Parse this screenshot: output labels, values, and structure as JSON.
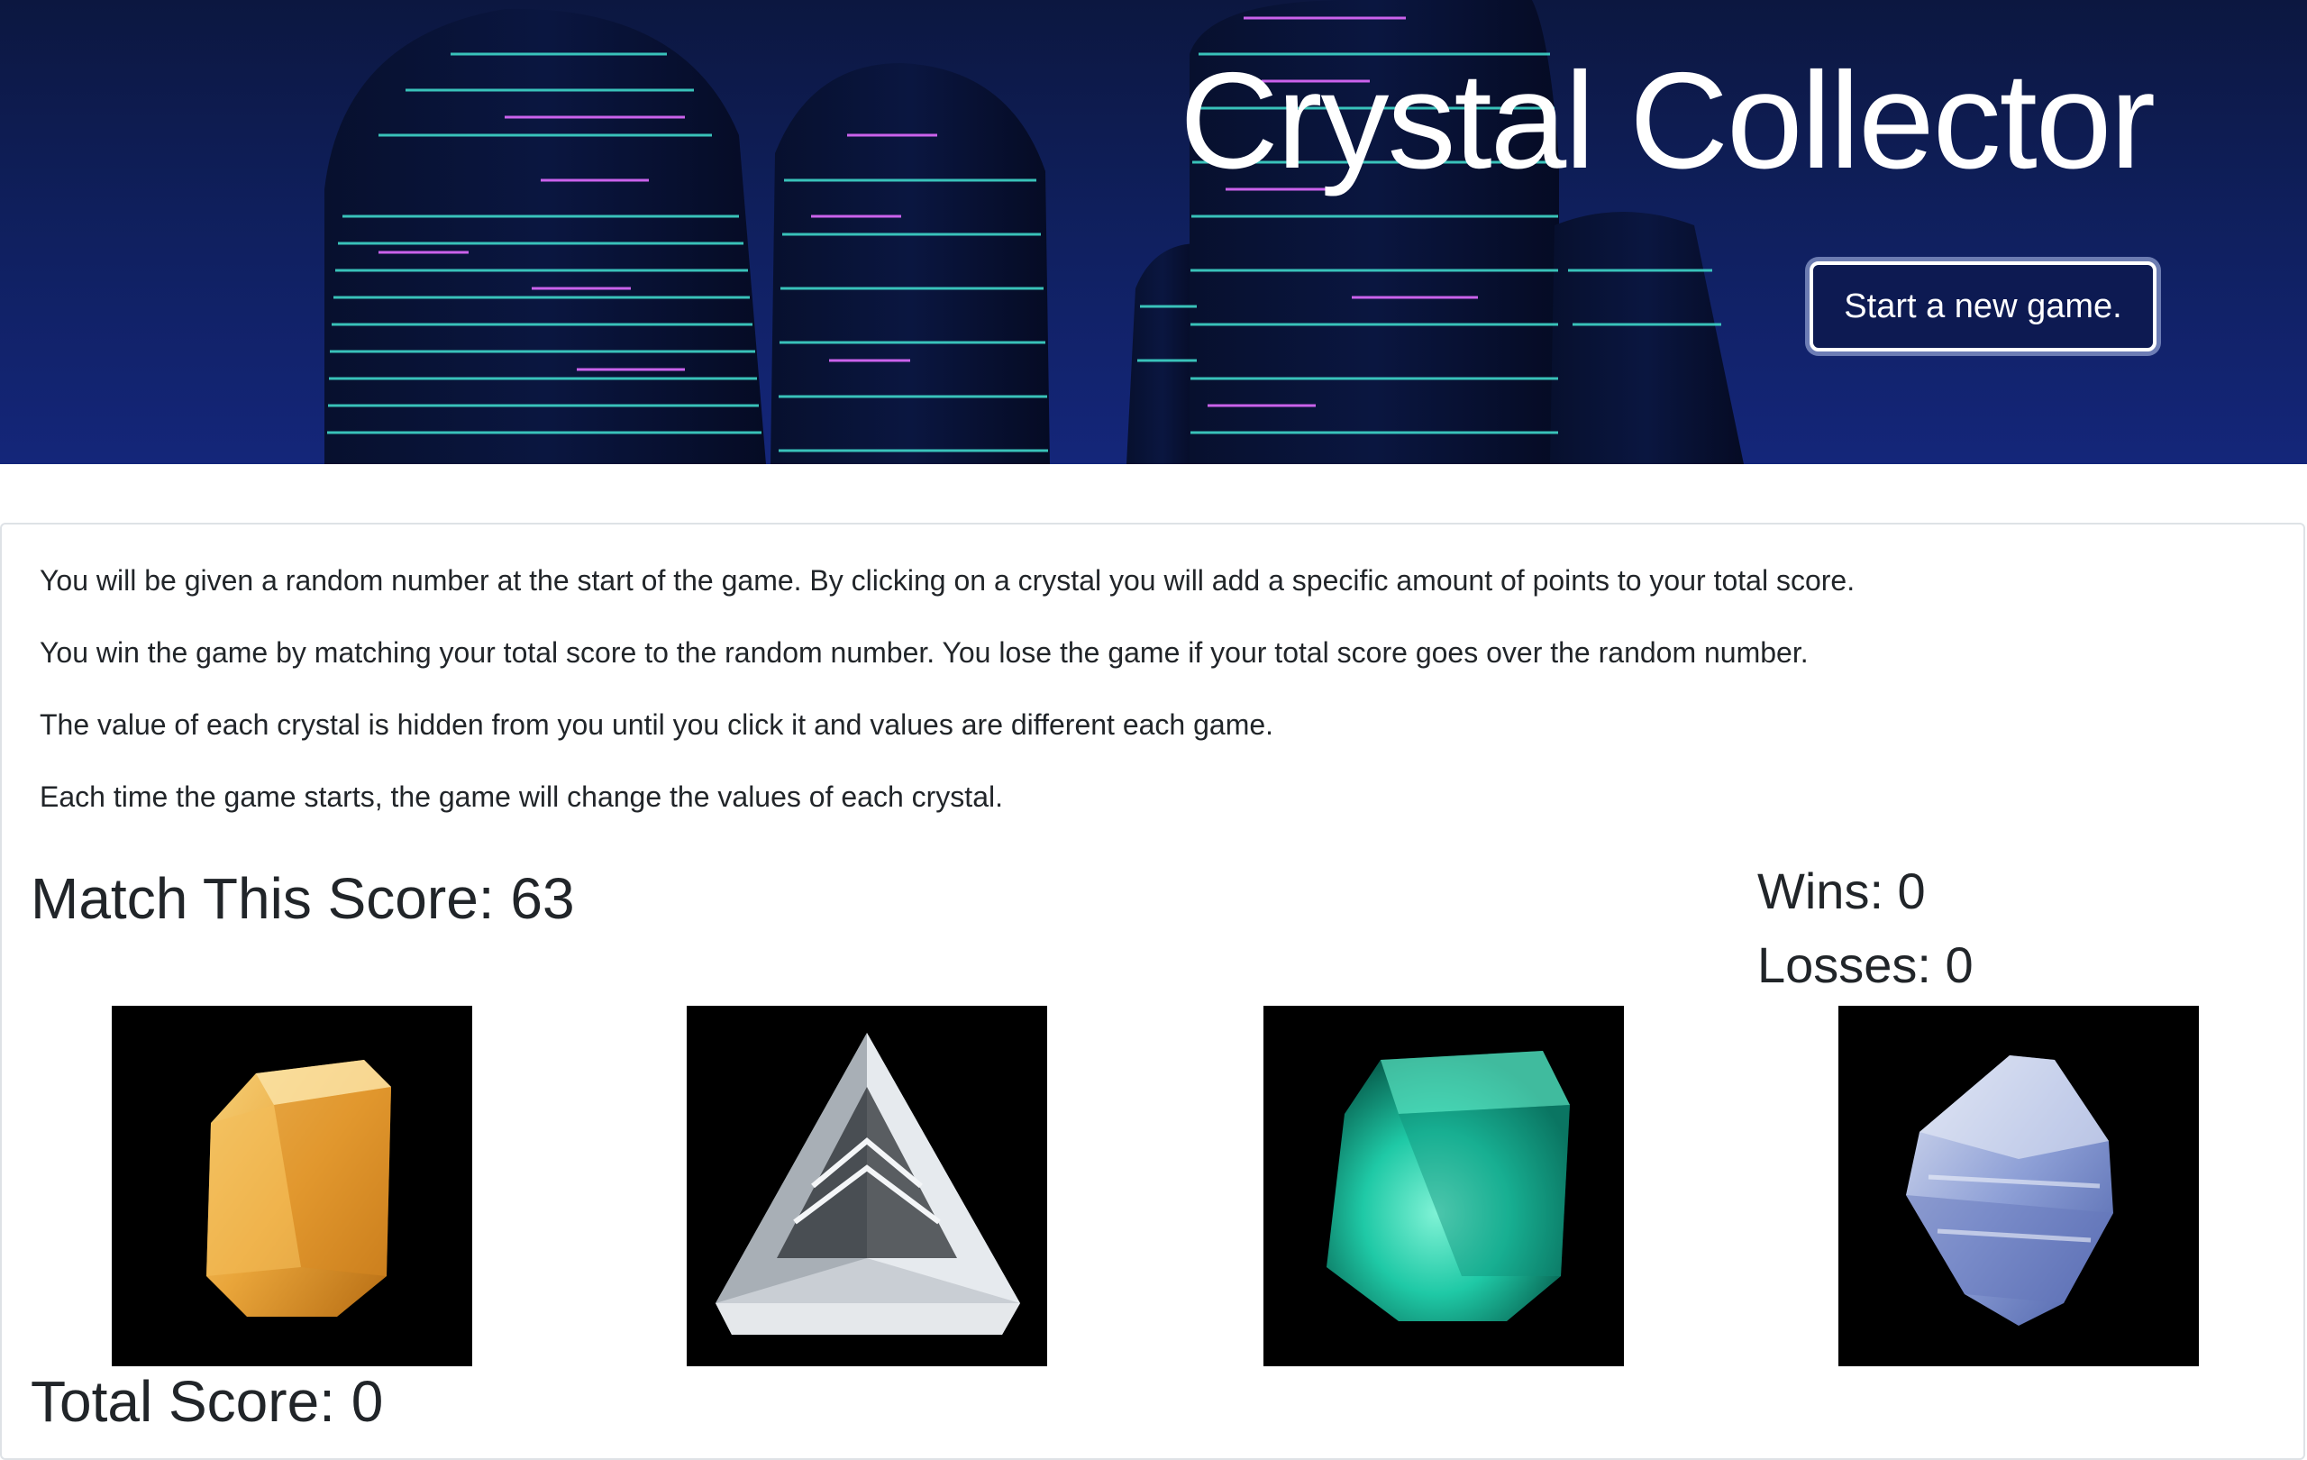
{
  "header": {
    "title": "Crystal Collector",
    "new_game_label": "Start a new game."
  },
  "instructions": [
    "You will be given a random number at the start of the game. By clicking on a crystal you will add a specific amount of points to your total score.",
    "You win the game by matching your total score to the random number. You lose the game if your total score goes over the random number.",
    "The value of each crystal is hidden from you until you click it and values are different each game.",
    "Each time the game starts, the game will change the values of each crystal."
  ],
  "scoreboard": {
    "match_label": "Match This Score: 63",
    "wins_label": "Wins: 0",
    "losses_label": "Losses: 0",
    "total_label": "Total Score: 0"
  },
  "crystals": [
    {
      "name": "yellow-crystal",
      "color": "#e9a53a"
    },
    {
      "name": "clear-diamond-crystal",
      "color": "#d8dde2"
    },
    {
      "name": "emerald-crystal",
      "color": "#1fc9a6"
    },
    {
      "name": "blue-sapphire-crystal",
      "color": "#8d9fd6"
    }
  ]
}
